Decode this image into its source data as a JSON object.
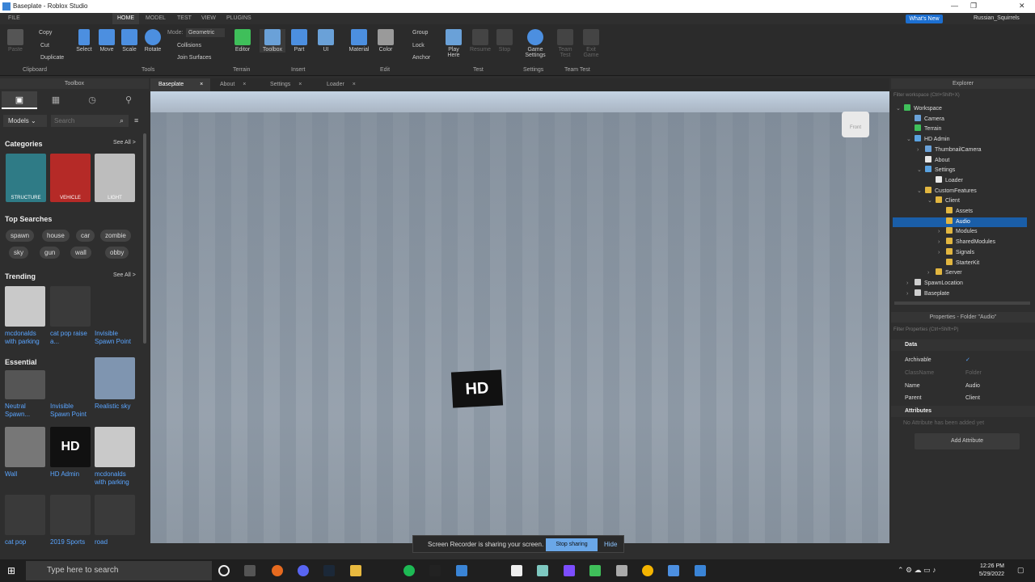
{
  "window": {
    "title": "Baseplate - Roblox Studio",
    "user": "Russian_Squirrels",
    "whats_new": "What's New"
  },
  "menubar": {
    "items": [
      "FILE",
      "HOME",
      "MODEL",
      "TEST",
      "VIEW",
      "PLUGINS"
    ],
    "active": "HOME"
  },
  "ribbon": {
    "clipboard": {
      "paste": "Paste",
      "copy": "Copy",
      "cut": "Cut",
      "duplicate": "Duplicate",
      "group": "Clipboard"
    },
    "tools": {
      "select": "Select",
      "move": "Move",
      "scale": "Scale",
      "rotate": "Rotate",
      "mode_label": "Mode:",
      "mode_value": "Geometric",
      "collisions": "Collisions",
      "join_surfaces": "Join Surfaces",
      "group": "Tools"
    },
    "terrain": {
      "editor": "Editor",
      "group": "Terrain"
    },
    "insert": {
      "toolbox": "Toolbox",
      "part": "Part",
      "ui": "UI",
      "group": "Insert"
    },
    "edit": {
      "material": "Material",
      "color": "Color",
      "group_btn": "Group",
      "lock": "Lock",
      "anchor": "Anchor",
      "group": "Edit"
    },
    "test": {
      "play_here": "Play Here",
      "resume": "Resume",
      "stop": "Stop",
      "group": "Test"
    },
    "settings": {
      "game_settings": "Game Settings",
      "group": "Settings"
    },
    "team_test": {
      "team_test": "Team Test",
      "exit_game": "Exit Game",
      "group": "Team Test"
    }
  },
  "toolbox": {
    "title": "Toolbox",
    "dropdown": "Models",
    "search_placeholder": "Search",
    "categories_title": "Categories",
    "see_all": "See All >",
    "categories": [
      {
        "label": "STRUCTURE",
        "color": "#2f7b86"
      },
      {
        "label": "VEHICLE",
        "color": "#b52a27"
      },
      {
        "label": "LIGHT",
        "color": "#bdbdbd"
      }
    ],
    "top_searches_title": "Top Searches",
    "top_searches": [
      "spawn",
      "house",
      "car",
      "zombie",
      "sky",
      "gun",
      "wall",
      "obby"
    ],
    "trending_title": "Trending",
    "trending": [
      "mcdonalds with parking",
      "cat pop raise a...",
      "Invisible Spawn Point"
    ],
    "essential_title": "Essential",
    "essential": [
      "Neutral Spawn...",
      "Invisible Spawn Point",
      "Realistic sky",
      "Wall",
      "HD Admin",
      "mcdonalds with parking",
      "cat pop",
      "2019 Sports",
      "road"
    ]
  },
  "tabs": [
    "Baseplate",
    "About",
    "Settings",
    "Loader"
  ],
  "viewport": {
    "logo": "HD",
    "cube_label": "Front"
  },
  "explorer": {
    "title": "Explorer",
    "filter": "Filter workspace (Ctrl+Shift+X)",
    "nodes": [
      {
        "label": "Workspace",
        "depth": 0,
        "arrow": "v",
        "color": "#3fbf5a"
      },
      {
        "label": "Camera",
        "depth": 1,
        "arrow": "",
        "color": "#6aa1d8"
      },
      {
        "label": "Terrain",
        "depth": 1,
        "arrow": "",
        "color": "#3fbf5a"
      },
      {
        "label": "HD Admin",
        "depth": 1,
        "arrow": "v",
        "color": "#5aa2e0"
      },
      {
        "label": "ThumbnailCamera",
        "depth": 2,
        "arrow": ">",
        "color": "#6aa1d8"
      },
      {
        "label": "About",
        "depth": 2,
        "arrow": "",
        "color": "#e8e8e8"
      },
      {
        "label": "Settings",
        "depth": 2,
        "arrow": "v",
        "color": "#5aa2e0"
      },
      {
        "label": "Loader",
        "depth": 3,
        "arrow": "",
        "color": "#e8e8e8"
      },
      {
        "label": "CustomFeatures",
        "depth": 2,
        "arrow": "v",
        "color": "#e2b640"
      },
      {
        "label": "Client",
        "depth": 3,
        "arrow": "v",
        "color": "#e2b640"
      },
      {
        "label": "Assets",
        "depth": 4,
        "arrow": "",
        "color": "#e2b640"
      },
      {
        "label": "Audio",
        "depth": 4,
        "arrow": "",
        "color": "#e2b640",
        "selected": true
      },
      {
        "label": "Modules",
        "depth": 4,
        "arrow": ">",
        "color": "#e2b640"
      },
      {
        "label": "SharedModules",
        "depth": 4,
        "arrow": ">",
        "color": "#e2b640"
      },
      {
        "label": "Signals",
        "depth": 4,
        "arrow": ">",
        "color": "#e2b640"
      },
      {
        "label": "StarterKit",
        "depth": 4,
        "arrow": "",
        "color": "#e2b640"
      },
      {
        "label": "Server",
        "depth": 3,
        "arrow": ">",
        "color": "#e2b640"
      },
      {
        "label": "SpawnLocation",
        "depth": 1,
        "arrow": ">",
        "color": "#cfcfcf"
      },
      {
        "label": "Baseplate",
        "depth": 1,
        "arrow": ">",
        "color": "#cfcfcf"
      }
    ]
  },
  "properties": {
    "title": "Properties - Folder \"Audio\"",
    "filter": "Filter Properties (Ctrl+Shift+P)",
    "data_title": "Data",
    "archivable": "Archivable",
    "check": "✓",
    "classname": "ClassName",
    "classname_value": "Folder",
    "name": "Name",
    "name_value": "Audio",
    "parent": "Parent",
    "parent_value": "Client",
    "attributes_title": "Attributes",
    "no_attr": "No Attribute has been added yet",
    "add_attribute": "Add Attribute"
  },
  "recorder": {
    "text": "Screen Recorder is sharing your screen.",
    "stop": "Stop sharing",
    "hide": "Hide"
  },
  "taskbar": {
    "search": "Type here to search",
    "time": "12:26 PM",
    "date": "5/29/2022"
  }
}
